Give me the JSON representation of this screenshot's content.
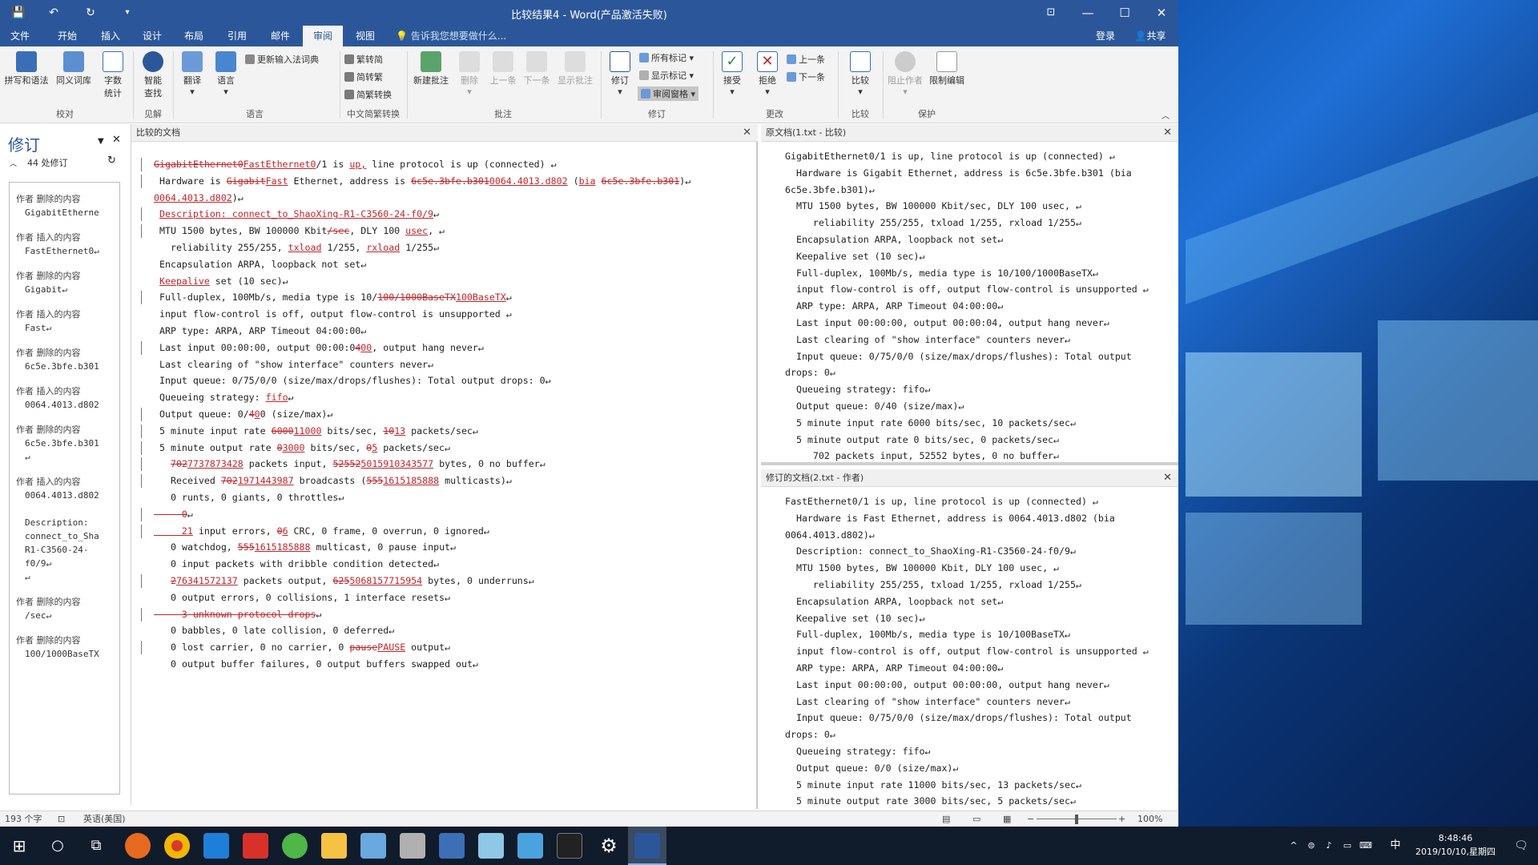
{
  "window": {
    "title": "比较结果4 - Word(产品激活失败)"
  },
  "quick_access": {
    "save": "💾",
    "undo": "↶",
    "redo": "↻",
    "customize": "▾"
  },
  "window_controls": {
    "ribbon_opts": "⊡",
    "minimize": "—",
    "maximize": "☐",
    "close": "✕"
  },
  "tabs": [
    "文件",
    "开始",
    "插入",
    "设计",
    "布局",
    "引用",
    "邮件",
    "审阅",
    "视图"
  ],
  "active_tab": "审阅",
  "tell_me": "告诉我您想要做什么...",
  "account": {
    "login": "登录",
    "share": "共享"
  },
  "ribbon": {
    "proofing": {
      "spell": "拼写和语法",
      "thesaurus": "同义词库",
      "wordcount": "字数\n统计",
      "label": "校对"
    },
    "insights": {
      "smart": "智能\n查找",
      "label": "见解"
    },
    "language": {
      "translate": "翻译",
      "language": "语言",
      "update_ime": "更新输入法词典",
      "label": "语言"
    },
    "chinese": {
      "t2s": "繁转简",
      "s2t": "简转繁",
      "convert": "简繁转换",
      "label": "中文简繁转换"
    },
    "comments": {
      "new": "新建批注",
      "delete": "删除",
      "prev": "上一条",
      "next": "下一条",
      "show": "显示批注",
      "label": "批注"
    },
    "tracking": {
      "track": "修订",
      "all_markup": "所有标记",
      "show_markup": "显示标记",
      "pane": "审阅窗格",
      "label": "修订"
    },
    "changes": {
      "accept": "接受",
      "reject": "拒绝",
      "prev": "上一条",
      "next": "下一条",
      "label": "更改"
    },
    "compare": {
      "compare": "比较",
      "label": "比较"
    },
    "protect": {
      "block": "阻止作者",
      "restrict": "限制编辑",
      "label": "保护"
    }
  },
  "revisions_pane": {
    "title": "修订",
    "count": "44 处修订",
    "items": [
      {
        "author": "作者",
        "kind": "删除的内容",
        "content": "GigabitEtherne"
      },
      {
        "author": "作者",
        "kind": "插入的内容",
        "content": "FastEthernet0↵"
      },
      {
        "author": "作者",
        "kind": "删除的内容",
        "content": "Gigabit↵"
      },
      {
        "author": "作者",
        "kind": "插入的内容",
        "content": "Fast↵"
      },
      {
        "author": "作者",
        "kind": "删除的内容",
        "content": "6c5e.3bfe.b301"
      },
      {
        "author": "作者",
        "kind": "插入的内容",
        "content": "0064.4013.d802"
      },
      {
        "author": "作者",
        "kind": "删除的内容",
        "content": "6c5e.3bfe.b301\n↵"
      },
      {
        "author": "作者",
        "kind": "插入的内容",
        "content": "0064.4013.d802\n\nDescription:\nconnect_to_Sha\nR1-C3560-24-\nf0/9↵\n↵"
      },
      {
        "author": "作者",
        "kind": "删除的内容",
        "content": "/sec↵"
      },
      {
        "author": "作者",
        "kind": "删除的内容",
        "content": "100/1000BaseTX"
      }
    ]
  },
  "panes": {
    "compared": "比较的文档",
    "original": "原文档(1.txt - 比较)",
    "revised": "修订的文档(2.txt - 作者)",
    "close": "✕"
  },
  "compared_lines": [
    {
      "i": 0,
      "bar": true,
      "s": [
        [
          "d",
          "GigabitEthernet0"
        ],
        [
          "i",
          "FastEthernet0"
        ],
        [
          "t",
          "/1 is "
        ],
        [
          "i",
          "up,"
        ],
        [
          "t",
          " line protocol is up (connected) ↵"
        ]
      ]
    },
    {
      "i": 1,
      "bar": true,
      "s": [
        [
          "t",
          "Hardware is "
        ],
        [
          "d",
          "Gigabit"
        ],
        [
          "i",
          "Fast"
        ],
        [
          "t",
          " Ethernet, address is "
        ],
        [
          "d",
          "6c5e.3bfe.b301"
        ],
        [
          "i",
          "0064.4013.d802"
        ],
        [
          "t",
          " ("
        ],
        [
          "i",
          "bia"
        ],
        [
          "t",
          " "
        ],
        [
          "d",
          "6c5e.3bfe.b301"
        ],
        [
          "t",
          ")↵"
        ]
      ]
    },
    {
      "i": 0,
      "bar": false,
      "s": [
        [
          "i",
          "0064.4013.d802"
        ],
        [
          "t",
          ")↵"
        ]
      ]
    },
    {
      "i": 1,
      "bar": true,
      "s": [
        [
          "i",
          "Description: connect_to_ShaoXing-R1-C3560-24-f0/9"
        ],
        [
          "t",
          "↵"
        ]
      ]
    },
    {
      "i": 1,
      "bar": true,
      "s": [
        [
          "t",
          "MTU 1500 bytes, BW 100000 Kbit"
        ],
        [
          "d",
          "/sec"
        ],
        [
          "t",
          ", DLY 100 "
        ],
        [
          "i",
          "usec"
        ],
        [
          "t",
          ", ↵"
        ]
      ]
    },
    {
      "i": 3,
      "bar": false,
      "s": [
        [
          "t",
          "reliability 255/255, "
        ],
        [
          "i",
          "txload"
        ],
        [
          "t",
          " 1/255, "
        ],
        [
          "i",
          "rxload"
        ],
        [
          "t",
          " 1/255↵"
        ]
      ]
    },
    {
      "i": 1,
      "bar": false,
      "s": [
        [
          "t",
          "Encapsulation ARPA, loopback not set↵"
        ]
      ]
    },
    {
      "i": 1,
      "bar": false,
      "s": [
        [
          "i",
          "Keepalive"
        ],
        [
          "t",
          " set (10 sec)↵"
        ]
      ]
    },
    {
      "i": 1,
      "bar": true,
      "s": [
        [
          "t",
          "Full-duplex, 100Mb/s, media type is 10/"
        ],
        [
          "d",
          "100/1000BaseTX"
        ],
        [
          "i",
          "100BaseTX"
        ],
        [
          "t",
          "↵"
        ]
      ]
    },
    {
      "i": 1,
      "bar": false,
      "s": [
        [
          "t",
          "input flow-control is off, output flow-control is unsupported ↵"
        ]
      ]
    },
    {
      "i": 1,
      "bar": false,
      "s": [
        [
          "t",
          "ARP type: ARPA, ARP Timeout 04:00:00↵"
        ]
      ]
    },
    {
      "i": 1,
      "bar": true,
      "s": [
        [
          "t",
          "Last input 00:00:00, output 00:00:0"
        ],
        [
          "d",
          "4"
        ],
        [
          "i",
          "00"
        ],
        [
          "t",
          ", output hang never↵"
        ]
      ]
    },
    {
      "i": 1,
      "bar": false,
      "s": [
        [
          "t",
          "Last clearing of \"show interface\" counters never↵"
        ]
      ]
    },
    {
      "i": 1,
      "bar": false,
      "s": [
        [
          "t",
          "Input queue: 0/75/0/0 (size/max/drops/flushes): Total output drops: 0↵"
        ]
      ]
    },
    {
      "i": 1,
      "bar": false,
      "s": [
        [
          "t",
          "Queueing strategy: "
        ],
        [
          "i",
          "fifo"
        ],
        [
          "t",
          "↵"
        ]
      ]
    },
    {
      "i": 1,
      "bar": true,
      "s": [
        [
          "t",
          "Output queue: 0/"
        ],
        [
          "d",
          "4"
        ],
        [
          "i",
          "0"
        ],
        [
          "t",
          "0 (size/max)↵"
        ]
      ]
    },
    {
      "i": 1,
      "bar": true,
      "s": [
        [
          "t",
          "5 minute input rate "
        ],
        [
          "d",
          "6000"
        ],
        [
          "i",
          "11000"
        ],
        [
          "t",
          " bits/sec, "
        ],
        [
          "d",
          "10"
        ],
        [
          "i",
          "13"
        ],
        [
          "t",
          " packets/sec↵"
        ]
      ]
    },
    {
      "i": 1,
      "bar": true,
      "s": [
        [
          "t",
          "5 minute output rate "
        ],
        [
          "d",
          "0"
        ],
        [
          "i",
          "3000"
        ],
        [
          "t",
          " bits/sec, "
        ],
        [
          "d",
          "0"
        ],
        [
          "i",
          "5"
        ],
        [
          "t",
          " packets/sec↵"
        ]
      ]
    },
    {
      "i": 3,
      "bar": true,
      "s": [
        [
          "d",
          "702"
        ],
        [
          "i",
          "7737873428"
        ],
        [
          "t",
          " packets input, "
        ],
        [
          "d",
          "52552"
        ],
        [
          "i",
          "5015910343577"
        ],
        [
          "t",
          " bytes, 0 no buffer↵"
        ]
      ]
    },
    {
      "i": 3,
      "bar": true,
      "s": [
        [
          "t",
          "Received "
        ],
        [
          "d",
          "702"
        ],
        [
          "i",
          "1971443987"
        ],
        [
          "t",
          " broadcasts ("
        ],
        [
          "d",
          "555"
        ],
        [
          "i",
          "1615185888"
        ],
        [
          "t",
          " multicasts)↵"
        ]
      ]
    },
    {
      "i": 3,
      "bar": false,
      "s": [
        [
          "t",
          "0 runts, 0 giants, 0 throttles↵"
        ]
      ]
    },
    {
      "i": 0,
      "bar": true,
      "s": [
        [
          "d",
          "     0"
        ],
        [
          "t",
          "↵"
        ]
      ]
    },
    {
      "i": 0,
      "bar": true,
      "s": [
        [
          "i",
          "     21"
        ],
        [
          "t",
          " input errors, "
        ],
        [
          "d",
          "0"
        ],
        [
          "i",
          "6"
        ],
        [
          "t",
          " CRC, 0 frame, 0 overrun, 0 ignored↵"
        ]
      ]
    },
    {
      "i": 3,
      "bar": false,
      "s": [
        [
          "t",
          "0 watchdog, "
        ],
        [
          "d",
          "555"
        ],
        [
          "i",
          "1615185888"
        ],
        [
          "t",
          " multicast, 0 pause input↵"
        ]
      ]
    },
    {
      "i": 3,
      "bar": false,
      "s": [
        [
          "t",
          "0 input packets with dribble condition detected↵"
        ]
      ]
    },
    {
      "i": 3,
      "bar": true,
      "s": [
        [
          "d",
          "2"
        ],
        [
          "i",
          "76341572137"
        ],
        [
          "t",
          " packets output, "
        ],
        [
          "d",
          "625"
        ],
        [
          "i",
          "5068157715954"
        ],
        [
          "t",
          " bytes, 0 underruns↵"
        ]
      ]
    },
    {
      "i": 3,
      "bar": false,
      "s": [
        [
          "t",
          "0 output errors, 0 collisions, 1 interface resets↵"
        ]
      ]
    },
    {
      "i": 0,
      "bar": true,
      "s": [
        [
          "d",
          "     3 unknown protocol drops"
        ],
        [
          "t",
          "↵"
        ]
      ]
    },
    {
      "i": 3,
      "bar": false,
      "s": [
        [
          "t",
          "0 babbles, 0 late collision, 0 deferred↵"
        ]
      ]
    },
    {
      "i": 3,
      "bar": true,
      "s": [
        [
          "t",
          "0 lost carrier, 0 no carrier, 0 "
        ],
        [
          "d",
          "pause"
        ],
        [
          "i",
          "PAUSE"
        ],
        [
          "t",
          " output↵"
        ]
      ]
    },
    {
      "i": 3,
      "bar": false,
      "s": [
        [
          "t",
          "0 output buffer failures, 0 output buffers swapped out↵"
        ]
      ]
    }
  ],
  "original_lines": [
    "GigabitEthernet0/1 is up, line protocol is up (connected) ↵",
    "  Hardware is Gigabit Ethernet, address is 6c5e.3bfe.b301 (bia",
    "6c5e.3bfe.b301)↵",
    "  MTU 1500 bytes, BW 100000 Kbit/sec, DLY 100 usec, ↵",
    "     reliability 255/255, txload 1/255, rxload 1/255↵",
    "  Encapsulation ARPA, loopback not set↵",
    "  Keepalive set (10 sec)↵",
    "  Full-duplex, 100Mb/s, media type is 10/100/1000BaseTX↵",
    "  input flow-control is off, output flow-control is unsupported ↵",
    "  ARP type: ARPA, ARP Timeout 04:00:00↵",
    "  Last input 00:00:00, output 00:00:04, output hang never↵",
    "  Last clearing of \"show interface\" counters never↵",
    "  Input queue: 0/75/0/0 (size/max/drops/flushes): Total output",
    "drops: 0↵",
    "  Queueing strategy: fifo↵",
    "  Output queue: 0/40 (size/max)↵",
    "  5 minute input rate 6000 bits/sec, 10 packets/sec↵",
    "  5 minute output rate 0 bits/sec, 0 packets/sec↵",
    "     702 packets input, 52552 bytes, 0 no buffer↵"
  ],
  "revised_lines": [
    "FastEthernet0/1 is up, line protocol is up (connected) ↵",
    "  Hardware is Fast Ethernet, address is 0064.4013.d802 (bia",
    "0064.4013.d802)↵",
    "  Description: connect_to_ShaoXing-R1-C3560-24-f0/9↵",
    "  MTU 1500 bytes, BW 100000 Kbit, DLY 100 usec, ↵",
    "     reliability 255/255, txload 1/255, rxload 1/255↵",
    "  Encapsulation ARPA, loopback not set↵",
    "  Keepalive set (10 sec)↵",
    "  Full-duplex, 100Mb/s, media type is 10/100BaseTX↵",
    "  input flow-control is off, output flow-control is unsupported ↵",
    "  ARP type: ARPA, ARP Timeout 04:00:00↵",
    "  Last input 00:00:00, output 00:00:00, output hang never↵",
    "  Last clearing of \"show interface\" counters never↵",
    "  Input queue: 0/75/0/0 (size/max/drops/flushes): Total output",
    "drops: 0↵",
    "  Queueing strategy: fifo↵",
    "  Output queue: 0/0 (size/max)↵",
    "  5 minute input rate 11000 bits/sec, 13 packets/sec↵",
    "  5 minute output rate 3000 bits/sec, 5 packets/sec↵"
  ],
  "status": {
    "words": "193 个字",
    "lang": "英语(美国)",
    "zoom": "100%",
    "minus": "−",
    "plus": "+"
  },
  "taskbar": {
    "time": "8:48:46",
    "date": "2019/10/10,星期四",
    "ime": "中",
    "start": "⊞",
    "search": "○",
    "taskview": "⧉",
    "notify": "🗨",
    "tray_up": "^"
  },
  "colors": {
    "accent": "#2b579a",
    "revision": "#c0252b"
  }
}
